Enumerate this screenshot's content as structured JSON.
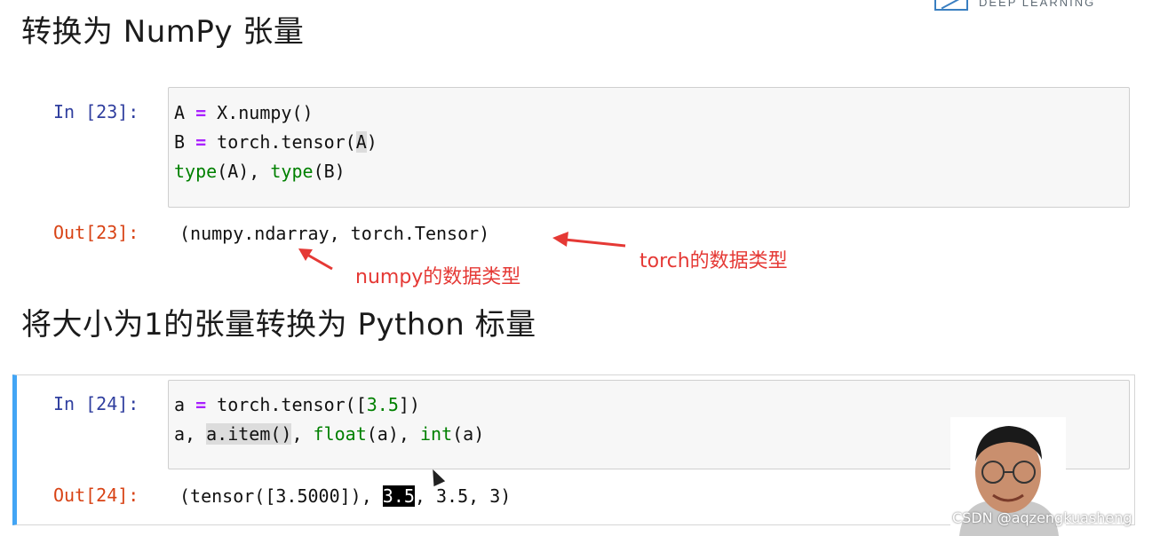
{
  "headings": {
    "section1": "转换为 NumPy 张量",
    "section2": "将大小为1的张量转换为 Python 标量"
  },
  "logo": {
    "text": "DEEP LEARNING"
  },
  "cell1": {
    "in_prompt": "In [23]:",
    "out_prompt": "Out[23]:",
    "code": {
      "line1": {
        "a": "A ",
        "op": "=",
        "b": " X.numpy()"
      },
      "line2": {
        "a": "B ",
        "op": "=",
        "b": " torch.tensor(",
        "hl": "A",
        "c": ")"
      },
      "line3": {
        "f1": "type",
        "a": "(A), ",
        "f2": "type",
        "b": "(B)"
      }
    },
    "output": "(numpy.ndarray, torch.Tensor)"
  },
  "cell2": {
    "in_prompt": "In [24]:",
    "out_prompt": "Out[24]:",
    "code": {
      "line1": {
        "a": "a ",
        "op": "=",
        "b": " torch.tensor([",
        "num": "3.5",
        "c": "])"
      },
      "line2": {
        "a": "a, ",
        "hl": "a.item()",
        "b": ", ",
        "f1": "float",
        "c": "(a), ",
        "f2": "int",
        "d": "(a)"
      }
    },
    "output": {
      "a": "(tensor([3.5000]), ",
      "sel": "3.5",
      "b": ", 3.5, 3)"
    }
  },
  "annotations": {
    "numpy_type": "numpy的数据类型",
    "torch_type": "torch的数据类型"
  },
  "watermark": "CSDN @aqzengkuasheng",
  "colors": {
    "in_prompt": "#303f9f",
    "out_prompt": "#d84315",
    "annotation": "#e53935",
    "operator": "#aa22ff",
    "builtin": "#008000",
    "selected_cell_border": "#42a5f5"
  }
}
